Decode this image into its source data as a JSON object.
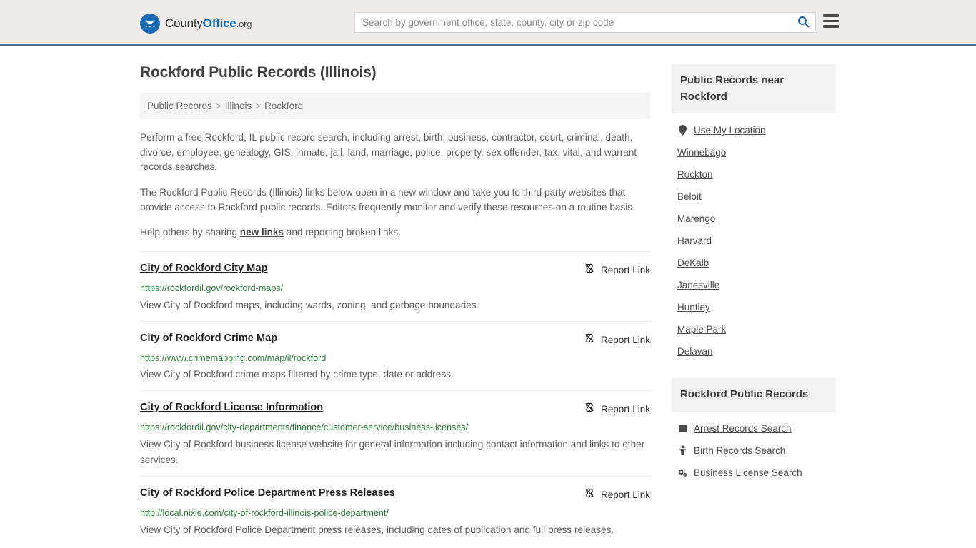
{
  "header": {
    "logo": {
      "icon": "eagle-shield-icon",
      "text_county": "County",
      "text_office": "Office",
      "text_org": ".org"
    },
    "search": {
      "placeholder": "Search by government office, state, county, city or zip code",
      "value": "",
      "search_icon": "search-icon"
    },
    "menu_icon": "hamburger-menu-icon",
    "accent_color": "#3b6e9f"
  },
  "main": {
    "title": "Rockford Public Records (Illinois)",
    "breadcrumb": {
      "items": [
        "Public Records",
        "Illinois",
        "Rockford"
      ],
      "separator": ">"
    },
    "intro_paragraph_1": "Perform a free Rockford, IL public record search, including arrest, birth, business, contractor, court, criminal, death, divorce, employee, genealogy, GIS, inmate, jail, land, marriage, police, property, sex offender, tax, vital, and warrant records searches.",
    "intro_paragraph_2": "The Rockford Public Records (Illinois) links below open in a new window and take you to third party websites that provide access to Rockford public records. Editors frequently monitor and verify these resources on a routine basis.",
    "help_prefix": "Help others by sharing ",
    "help_link": "new links",
    "help_suffix": " and reporting broken links.",
    "report_link_label": "Report Link",
    "report_link_icon": "broken-link-icon",
    "entries": [
      {
        "title": "City of Rockford City Map",
        "url": "https://rockfordil.gov/rockford-maps/",
        "description": "View City of Rockford maps, including wards, zoning, and garbage boundaries."
      },
      {
        "title": "City of Rockford Crime Map",
        "url": "https://www.crimemapping.com/map/il/rockford",
        "description": "View City of Rockford crime maps filtered by crime type, date or address."
      },
      {
        "title": "City of Rockford License Information",
        "url": "https://rockfordil.gov/city-departments/finance/customer-service/business-licenses/",
        "description": "View City of Rockford business license website for general information including contact information and links to other services."
      },
      {
        "title": "City of Rockford Police Department Press Releases",
        "url": "http://local.nixle.com/city-of-rockford-illinois-police-department/",
        "description": "View City of Rockford Police Department press releases, including dates of publication and full press releases."
      }
    ]
  },
  "sidebar": {
    "near_section": {
      "title": "Public Records near Rockford",
      "use_my_location": {
        "label": "Use My Location",
        "icon": "map-pin-icon"
      },
      "places": [
        "Winnebago",
        "Rockton",
        "Beloit",
        "Marengo",
        "Harvard",
        "DeKalb",
        "Janesville",
        "Huntley",
        "Maple Park",
        "Delavan"
      ]
    },
    "records_section": {
      "title": "Rockford Public Records",
      "items": [
        {
          "label": "Arrest Records Search",
          "icon": "fingerprint-icon"
        },
        {
          "label": "Birth Records Search",
          "icon": "baby-icon"
        },
        {
          "label": "Business License Search",
          "icon": "gears-icon"
        }
      ]
    }
  }
}
